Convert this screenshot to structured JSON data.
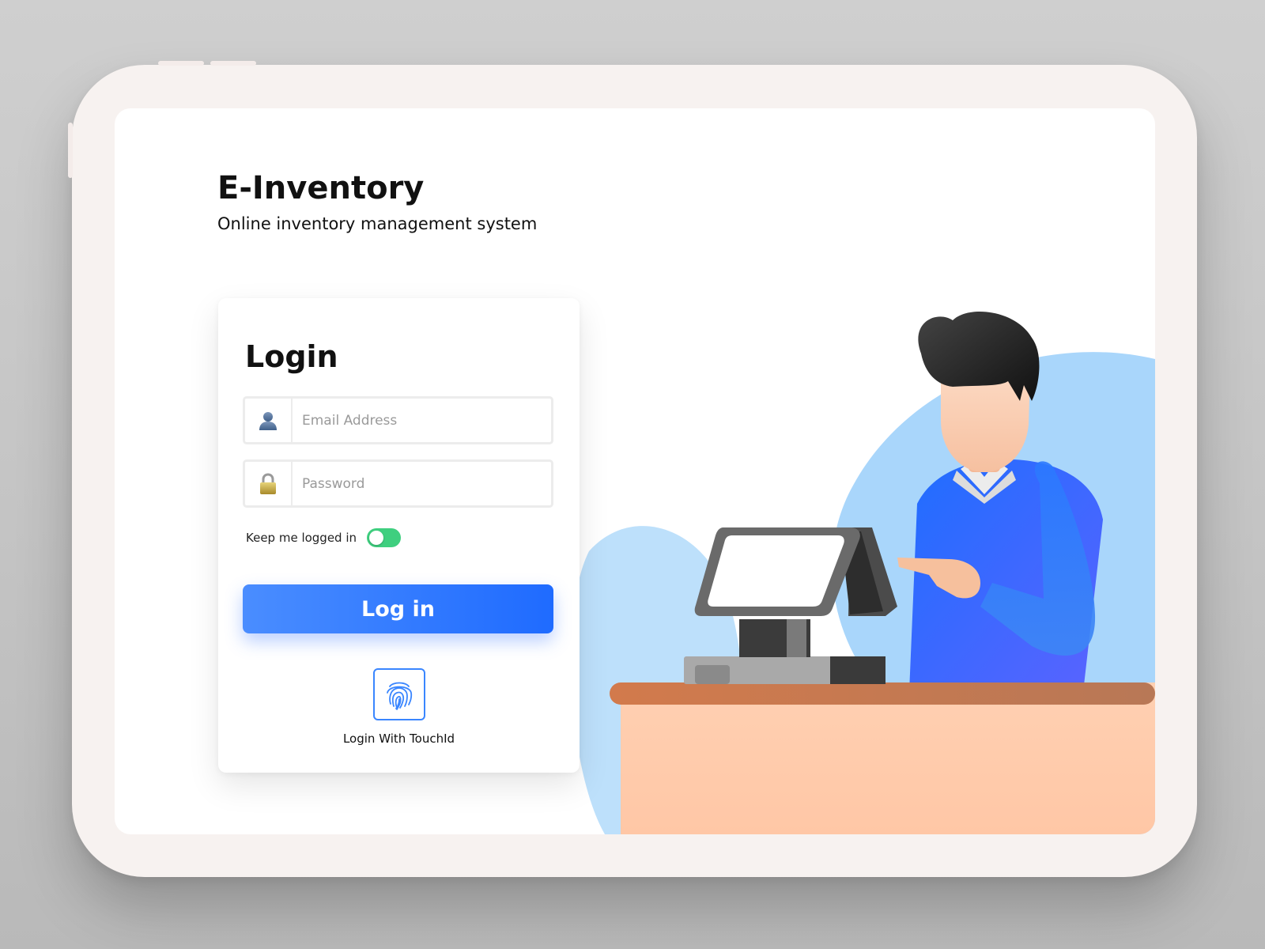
{
  "brand": {
    "title": "E-Inventory",
    "subtitle": "Online inventory management system"
  },
  "login": {
    "title": "Login",
    "email": {
      "placeholder": "Email Address",
      "value": "",
      "icon": "user-icon"
    },
    "password": {
      "placeholder": "Password",
      "value": "",
      "icon": "lock-icon"
    },
    "keep_logged_in": {
      "label": "Keep me logged in",
      "enabled": true
    },
    "submit_label": "Log in",
    "touch_id": {
      "label": "Login With TouchId",
      "icon": "fingerprint-icon"
    }
  },
  "colors": {
    "accent": "#3a86ff",
    "button_start": "#4a8dff",
    "button_end": "#1f6bff",
    "toggle_on": "#3fcf7f",
    "illustration_blob": "#aed8fb"
  }
}
